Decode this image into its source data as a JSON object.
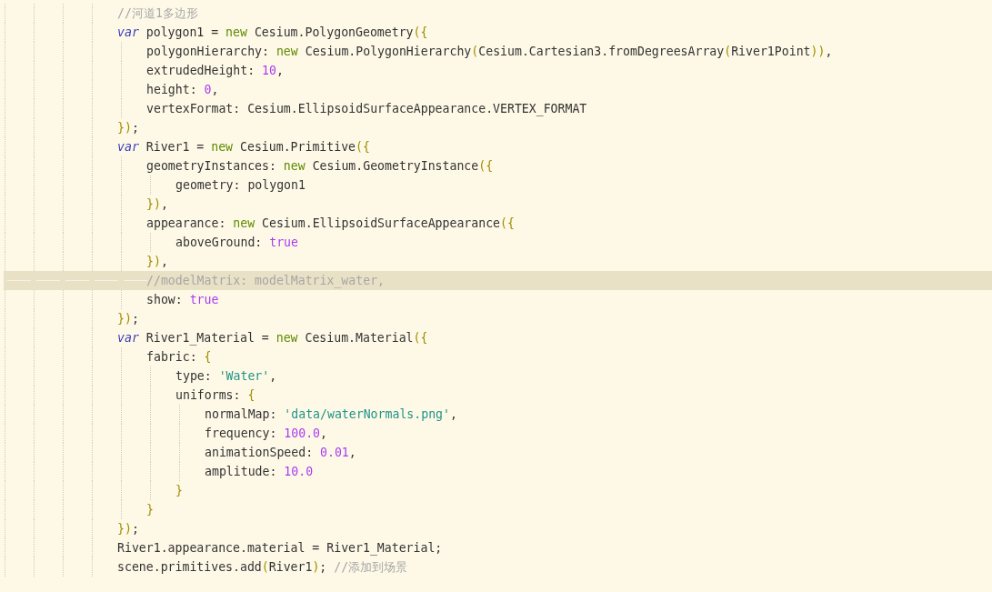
{
  "lines": [
    {
      "current": false,
      "tokens": [
        {
          "kind": "comment",
          "text": "//河道1多边形"
        }
      ]
    },
    {
      "current": false,
      "tokens": [
        {
          "kind": "kw",
          "text": "var"
        },
        {
          "kind": "plain",
          "text": " polygon1 = "
        },
        {
          "kind": "new",
          "text": "new"
        },
        {
          "kind": "plain",
          "text": " Cesium.PolygonGeometry"
        },
        {
          "kind": "punct",
          "text": "({"
        }
      ],
      "children": [
        {
          "current": false,
          "tokens": [
            {
              "kind": "plain",
              "text": "polygonHierarchy: "
            },
            {
              "kind": "new",
              "text": "new"
            },
            {
              "kind": "plain",
              "text": " Cesium.PolygonHierarchy"
            },
            {
              "kind": "punct",
              "text": "("
            },
            {
              "kind": "plain",
              "text": "Cesium.Cartesian3.fromDegreesArray"
            },
            {
              "kind": "punct",
              "text": "("
            },
            {
              "kind": "plain",
              "text": "River1Point"
            },
            {
              "kind": "punct",
              "text": "))"
            },
            {
              "kind": "plain",
              "text": ","
            }
          ]
        },
        {
          "current": false,
          "tokens": [
            {
              "kind": "plain",
              "text": "extrudedHeight: "
            },
            {
              "kind": "num",
              "text": "10"
            },
            {
              "kind": "plain",
              "text": ","
            }
          ]
        },
        {
          "current": false,
          "tokens": [
            {
              "kind": "plain",
              "text": "height: "
            },
            {
              "kind": "num",
              "text": "0"
            },
            {
              "kind": "plain",
              "text": ","
            }
          ]
        },
        {
          "current": false,
          "tokens": [
            {
              "kind": "plain",
              "text": "vertexFormat: Cesium.EllipsoidSurfaceAppearance.VERTEX_FORMAT"
            }
          ]
        }
      ]
    },
    {
      "current": false,
      "tokens": [
        {
          "kind": "punct",
          "text": "})"
        },
        {
          "kind": "plain",
          "text": ";"
        }
      ]
    },
    {
      "current": false,
      "tokens": [
        {
          "kind": "kw",
          "text": "var"
        },
        {
          "kind": "plain",
          "text": " River1 = "
        },
        {
          "kind": "new",
          "text": "new"
        },
        {
          "kind": "plain",
          "text": " Cesium.Primitive"
        },
        {
          "kind": "punct",
          "text": "({"
        }
      ],
      "children": [
        {
          "current": false,
          "tokens": [
            {
              "kind": "plain",
              "text": "geometryInstances: "
            },
            {
              "kind": "new",
              "text": "new"
            },
            {
              "kind": "plain",
              "text": " Cesium.GeometryInstance"
            },
            {
              "kind": "punct",
              "text": "({"
            }
          ],
          "children": [
            {
              "current": false,
              "tokens": [
                {
                  "kind": "plain",
                  "text": "geometry: polygon1"
                }
              ]
            }
          ]
        },
        {
          "current": false,
          "tokens": [
            {
              "kind": "punct",
              "text": "})"
            },
            {
              "kind": "plain",
              "text": ","
            }
          ]
        },
        {
          "current": false,
          "tokens": [
            {
              "kind": "plain",
              "text": "appearance: "
            },
            {
              "kind": "new",
              "text": "new"
            },
            {
              "kind": "plain",
              "text": " Cesium.EllipsoidSurfaceAppearance"
            },
            {
              "kind": "punct",
              "text": "({"
            }
          ],
          "children": [
            {
              "current": false,
              "tokens": [
                {
                  "kind": "plain",
                  "text": "aboveGround: "
                },
                {
                  "kind": "num",
                  "text": "true"
                }
              ]
            }
          ]
        },
        {
          "current": false,
          "tokens": [
            {
              "kind": "punct",
              "text": "})"
            },
            {
              "kind": "plain",
              "text": ","
            }
          ]
        },
        {
          "current": true,
          "tokens": [
            {
              "kind": "comment",
              "text": "//modelMatrix: modelMatrix_water,"
            }
          ]
        },
        {
          "current": false,
          "tokens": [
            {
              "kind": "plain",
              "text": "show: "
            },
            {
              "kind": "num",
              "text": "true"
            }
          ]
        }
      ]
    },
    {
      "current": false,
      "tokens": [
        {
          "kind": "punct",
          "text": "})"
        },
        {
          "kind": "plain",
          "text": ";"
        }
      ]
    },
    {
      "current": false,
      "tokens": [
        {
          "kind": "kw",
          "text": "var"
        },
        {
          "kind": "plain",
          "text": " River1_Material = "
        },
        {
          "kind": "new",
          "text": "new"
        },
        {
          "kind": "plain",
          "text": " Cesium.Material"
        },
        {
          "kind": "punct",
          "text": "({"
        }
      ],
      "children": [
        {
          "current": false,
          "tokens": [
            {
              "kind": "plain",
              "text": "fabric: "
            },
            {
              "kind": "punct",
              "text": "{"
            }
          ],
          "children": [
            {
              "current": false,
              "tokens": [
                {
                  "kind": "plain",
                  "text": "type: "
                },
                {
                  "kind": "str",
                  "text": "'Water'"
                },
                {
                  "kind": "plain",
                  "text": ","
                }
              ]
            },
            {
              "current": false,
              "tokens": [
                {
                  "kind": "plain",
                  "text": "uniforms: "
                },
                {
                  "kind": "punct",
                  "text": "{"
                }
              ],
              "children": [
                {
                  "current": false,
                  "tokens": [
                    {
                      "kind": "plain",
                      "text": "normalMap: "
                    },
                    {
                      "kind": "str",
                      "text": "'data/waterNormals.png'"
                    },
                    {
                      "kind": "plain",
                      "text": ","
                    }
                  ]
                },
                {
                  "current": false,
                  "tokens": [
                    {
                      "kind": "plain",
                      "text": "frequency: "
                    },
                    {
                      "kind": "num",
                      "text": "100.0"
                    },
                    {
                      "kind": "plain",
                      "text": ","
                    }
                  ]
                },
                {
                  "current": false,
                  "tokens": [
                    {
                      "kind": "plain",
                      "text": "animationSpeed: "
                    },
                    {
                      "kind": "num",
                      "text": "0.01"
                    },
                    {
                      "kind": "plain",
                      "text": ","
                    }
                  ]
                },
                {
                  "current": false,
                  "tokens": [
                    {
                      "kind": "plain",
                      "text": "amplitude: "
                    },
                    {
                      "kind": "num",
                      "text": "10.0"
                    }
                  ]
                }
              ]
            },
            {
              "current": false,
              "tokens": [
                {
                  "kind": "punct",
                  "text": "}"
                }
              ]
            }
          ]
        },
        {
          "current": false,
          "tokens": [
            {
              "kind": "punct",
              "text": "}"
            }
          ]
        }
      ]
    },
    {
      "current": false,
      "tokens": [
        {
          "kind": "punct",
          "text": "})"
        },
        {
          "kind": "plain",
          "text": ";"
        }
      ]
    },
    {
      "current": false,
      "tokens": [
        {
          "kind": "plain",
          "text": "River1.appearance.material = River1_Material;"
        }
      ]
    },
    {
      "current": false,
      "tokens": [
        {
          "kind": "plain",
          "text": "scene.primitives.add"
        },
        {
          "kind": "punct",
          "text": "("
        },
        {
          "kind": "plain",
          "text": "River1"
        },
        {
          "kind": "punct",
          "text": ")"
        },
        {
          "kind": "plain",
          "text": "; "
        },
        {
          "kind": "comment",
          "text": "//添加到场景"
        }
      ]
    }
  ]
}
